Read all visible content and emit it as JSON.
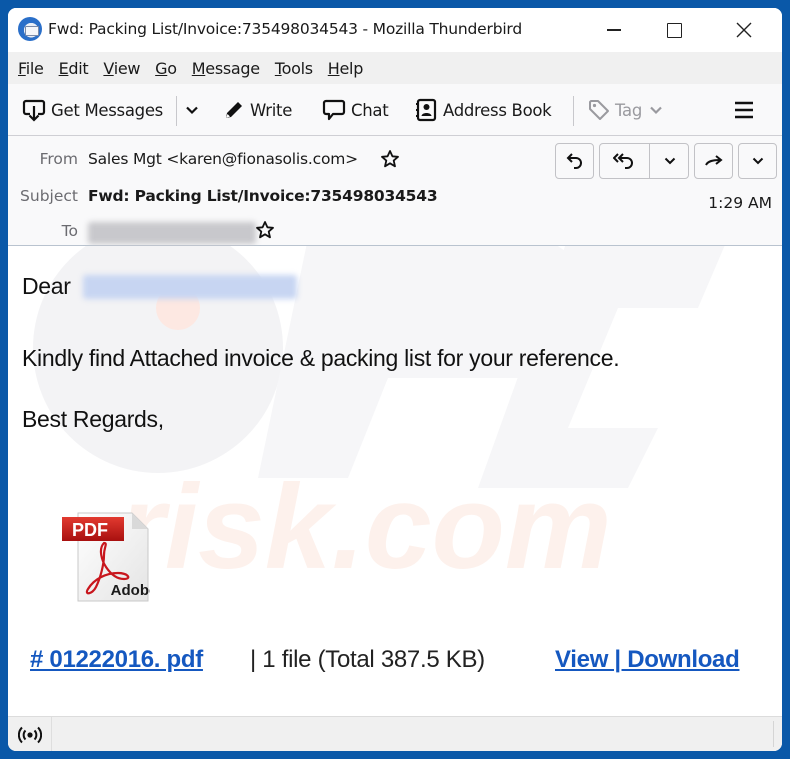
{
  "window": {
    "title": "Fwd: Packing List/Invoice:735498034543 - Mozilla Thunderbird",
    "controls": {
      "minimize": "minimize",
      "maximize": "maximize",
      "close": "✕"
    }
  },
  "menubar": {
    "items": [
      {
        "access_key": "F",
        "rest": "ile"
      },
      {
        "access_key": "E",
        "rest": "dit"
      },
      {
        "access_key": "V",
        "rest": "iew"
      },
      {
        "access_key": "G",
        "rest": "o"
      },
      {
        "access_key": "M",
        "rest": "essage"
      },
      {
        "access_key": "T",
        "rest": "ools"
      },
      {
        "access_key": "H",
        "rest": "elp"
      }
    ]
  },
  "toolbar": {
    "get_messages": "Get Messages",
    "write": "Write",
    "chat": "Chat",
    "address_book": "Address Book",
    "tag": "Tag",
    "icons": {
      "get_messages": "download-tray-icon",
      "dropdown": "chevron-down-icon",
      "write": "pencil-icon",
      "chat": "chat-bubble-icon",
      "address_book": "contact-card-icon",
      "tag": "tag-icon",
      "menu": "hamburger-menu-icon"
    }
  },
  "header": {
    "from_label": "From",
    "from_value": "Sales Mgt <karen@fionasolis.com>",
    "subject_label": "Subject",
    "subject_value": "Fwd: Packing List/Invoice:735498034543",
    "to_label": "To",
    "to_value_redacted": true,
    "date": "1:29 AM",
    "actions": [
      "reply",
      "reply-all",
      "reply-all-dropdown",
      "forward",
      "more-dropdown"
    ]
  },
  "body": {
    "greeting": "Dear",
    "greeting_recipient_redacted": true,
    "paragraph": "Kindly find Attached invoice & packing list for your reference.",
    "closing": "Best Regards,",
    "pdf_icon": {
      "tab_label": "PDF",
      "brand_label": "Adobe"
    }
  },
  "attachment": {
    "filename": "# 01222016. pdf",
    "info": "| 1 file (Total 387.5 KB)",
    "actions": "View | Download"
  },
  "colors": {
    "link": "#1558c0",
    "desktop": "#0a58a8",
    "pdf_red": "#c8161d"
  }
}
